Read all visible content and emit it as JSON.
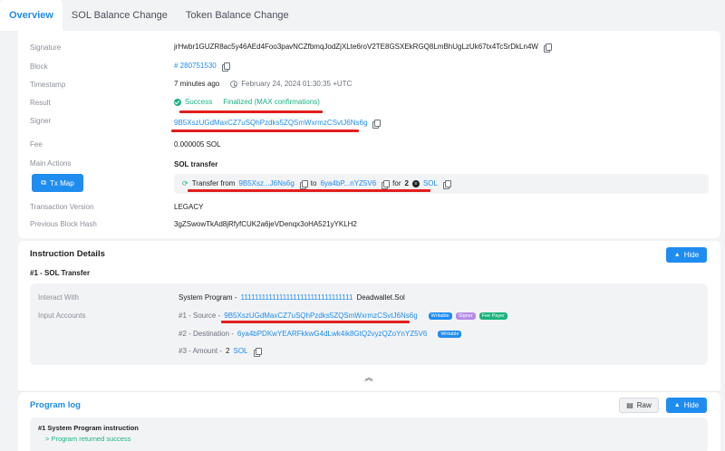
{
  "tabs": [
    "Overview",
    "SOL Balance Change",
    "Token Balance Change"
  ],
  "overview": {
    "signature_label": "Signature",
    "signature": "jrHwbr1GUZR8ac5y46AEd4Foo3pavNCZfbmqJodZjXLte6roV2TE8GSXEkRGQ8LmBhUgLzUk67tx4TcSrDkLn4W",
    "block_label": "Block",
    "block": "# 280751530",
    "timestamp_label": "Timestamp",
    "timestamp_rel": "7 minutes ago",
    "timestamp_abs": "February 24, 2024 01:30:35 +UTC",
    "result_label": "Result",
    "result_status": "Success",
    "result_finality": "Finalized (MAX confirmations)",
    "signer_label": "Signer",
    "signer": "9B5XszUGdMaxCZ7uSQhPzdks5ZQSmWxrmzCSvtJ6Ns6g",
    "fee_label": "Fee",
    "fee": "0.000005 SOL",
    "main_actions_label": "Main Actions",
    "main_action_title": "SOL transfer",
    "tx_map_label": "Tx Map",
    "transfer": {
      "prefix": "Transfer from",
      "from": "9B5Xsz...J6Ns6g",
      "to_word": "to",
      "to": "6ya4bP...nYZ5V6",
      "for_word": "for",
      "amount": "2",
      "token": "SOL"
    },
    "tx_version_label": "Transaction Version",
    "tx_version": "LEGACY",
    "prev_hash_label": "Previous Block Hash",
    "prev_hash": "3gZSwowTkAd8jRfyfCUK2a6jeVDenqx3oHA521yYKLH2"
  },
  "instructions": {
    "title": "Instruction Details",
    "hide_label": "Hide",
    "item_title": "#1 - SOL Transfer",
    "interact_label": "Interact With",
    "interact_prefix": "System Program -",
    "interact_program": "11111111111111111111111111111111",
    "interact_name": "Deadwallet.Sol",
    "input_label": "Input Accounts",
    "source_prefix": "#1 - Source -",
    "source": "9B5XszUGdMaxCZ7uSQhPzdks5ZQSmWxrmzCSvtJ6Ns6g",
    "source_badges": [
      "Writable",
      "Signer",
      "Fee Payer"
    ],
    "dest_prefix": "#2 - Destination -",
    "destination": "6ya4bPDKwYEARFkkwG4dLwk4ik8GtQ2vyzQZoYnYZ5V6",
    "dest_badges": [
      "Writable"
    ],
    "amount_prefix": "#3 - Amount -",
    "amount": "2",
    "amount_token": "SOL"
  },
  "program_log": {
    "title": "Program log",
    "raw_label": "Raw",
    "hide_label": "Hide",
    "entry_title": "#1 System Program instruction",
    "entry_line": "> Program returned success"
  },
  "colors": {
    "accent": "#1f8cf0",
    "success": "#19b37d",
    "highlight": "#e31d1d"
  }
}
